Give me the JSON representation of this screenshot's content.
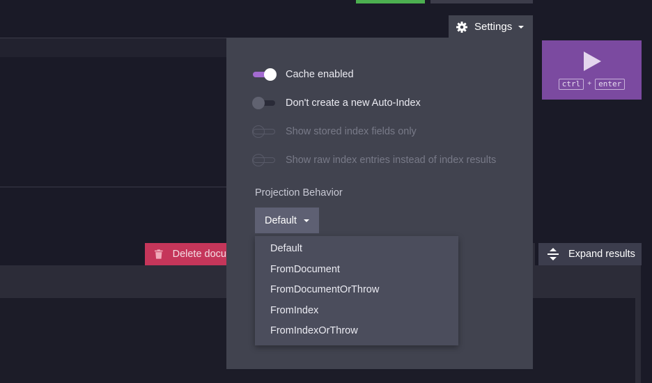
{
  "settings": {
    "title": "Settings",
    "toggles": [
      {
        "label": "Cache enabled",
        "state": "on"
      },
      {
        "label": "Don't create a new Auto-Index",
        "state": "off"
      },
      {
        "label": "Show stored index fields only",
        "state": "disabled"
      },
      {
        "label": "Show raw index entries instead of index results",
        "state": "disabled"
      }
    ],
    "projection": {
      "label": "Projection Behavior",
      "selected": "Default",
      "options": [
        "Default",
        "FromDocument",
        "FromDocumentOrThrow",
        "FromIndex",
        "FromIndexOrThrow"
      ]
    }
  },
  "run": {
    "shortcut_keys": [
      "ctrl",
      "enter"
    ],
    "shortcut_separator": "+"
  },
  "results": {
    "delete_label": "Delete docu",
    "expand_label": "Expand results"
  },
  "colors": {
    "accent_purple": "#7b4aa0",
    "toggle_on": "#a36bd0",
    "delete_red": "#c5365a",
    "status_green": "#4caf50"
  }
}
